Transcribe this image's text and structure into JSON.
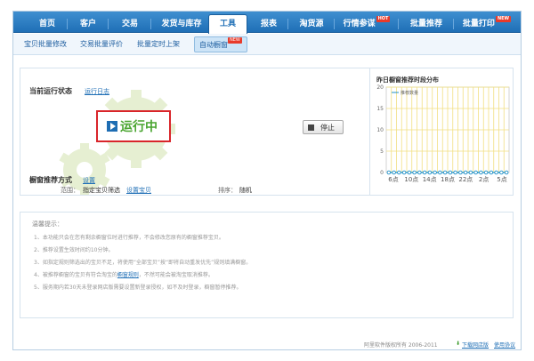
{
  "topnav": {
    "tabs": [
      {
        "label": "首页",
        "active": false
      },
      {
        "label": "客户",
        "active": false
      },
      {
        "label": "交易",
        "active": false
      },
      {
        "label": "发货与库存",
        "active": false
      },
      {
        "label": "工具",
        "active": true
      },
      {
        "label": "报表",
        "active": false
      },
      {
        "label": "淘货源",
        "active": false
      },
      {
        "label": "行情参谋",
        "badge": "HOT",
        "active": false
      },
      {
        "label": "批量推荐",
        "active": false
      },
      {
        "label": "批量打印",
        "badge": "NEW",
        "active": false
      }
    ]
  },
  "subnav": {
    "items": [
      {
        "label": "宝贝批量修改"
      },
      {
        "label": "交易批量评价"
      },
      {
        "label": "批量定时上架"
      },
      {
        "label": "自动橱窗",
        "badge": "NEW",
        "active": true
      }
    ]
  },
  "status": {
    "section_label": "当前运行状态",
    "log_link": "运行日志",
    "state_text": "运行中",
    "stop_label": "停止"
  },
  "recommend": {
    "section_label": "橱窗推荐方式",
    "settings_link": "设置",
    "range_label": "范围：",
    "range_value": "指定宝贝筛选",
    "range_link": "设置宝贝",
    "sort_label": "排序：",
    "sort_value": "随机"
  },
  "chart_data": {
    "type": "line",
    "title": "昨日橱窗推荐时段分布",
    "legend": "推荐数量",
    "x": [
      "6点",
      "10点",
      "14点",
      "18点",
      "22点",
      "2点",
      "5点"
    ],
    "y_ticks": [
      0,
      5,
      10,
      15,
      20
    ],
    "ylim": [
      0,
      20
    ],
    "series": [
      {
        "name": "推荐数量",
        "values": [
          0,
          0,
          0,
          0,
          0,
          0,
          0,
          0,
          0,
          0,
          0,
          0,
          0,
          0,
          0,
          0,
          0,
          0,
          0,
          0,
          0,
          0,
          0,
          0
        ]
      }
    ],
    "colors": {
      "line": "#1e90c8",
      "grid": "#f2df82"
    }
  },
  "tips": {
    "title": "温馨提示：",
    "lines": [
      "1、本功能只会在您有剩余橱窗位时进行推荐，不会修改您原有的橱窗推荐宝贝。",
      "2、推荐设置生效时间约10分钟。",
      "3、如指定规则筛选出的宝贝不足，将使用“全部宝贝”按“即将自动重发优先”规则填满橱窗。",
      "4、被推荐橱窗的宝贝有符合淘宝的",
      "5、服务期内若30天未登录网店版需要设置新登录授权，如不及时登录，橱窗暂停推荐。"
    ],
    "line4_link": "橱窗规则",
    "line4_tail": "，不然可能会被淘宝取消推荐。"
  },
  "footer": {
    "copyright": "阿里软件版权所有  2006-2011",
    "download": "下载网店版",
    "agreement": "使用协议"
  }
}
